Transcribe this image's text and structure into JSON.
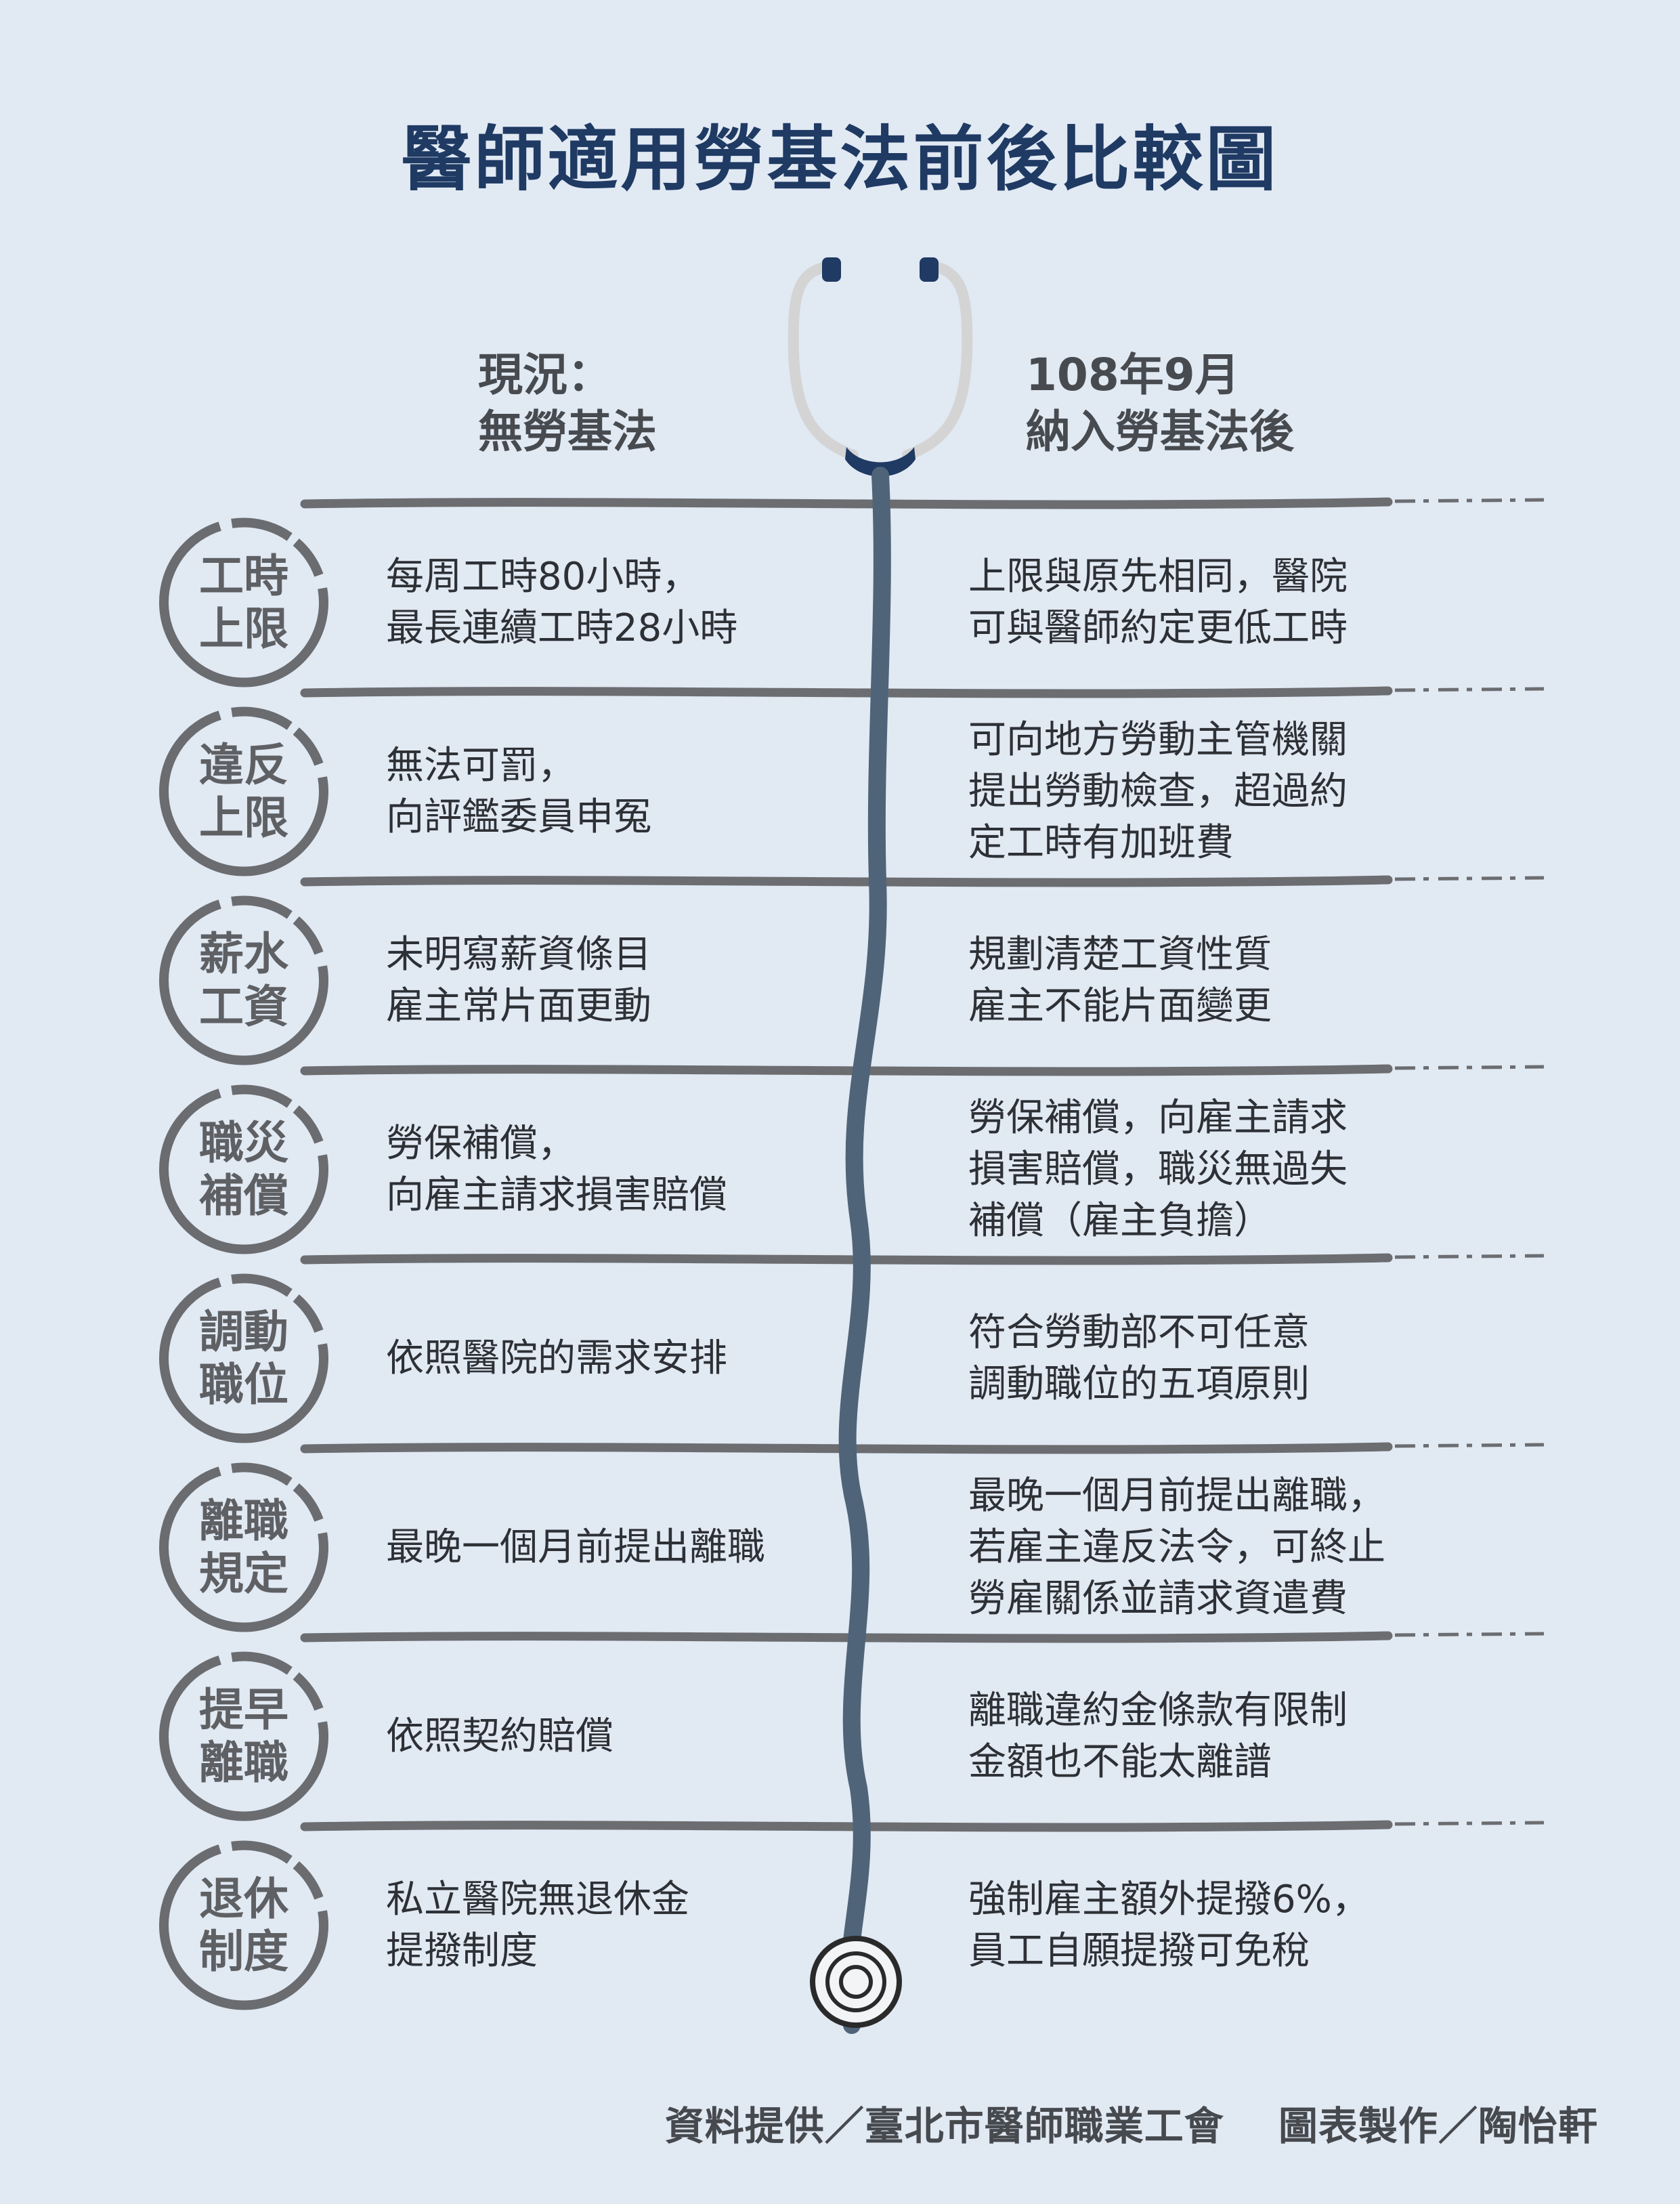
{
  "title": "醫師適用勞基法前後比較圖",
  "header": {
    "left": [
      "現況：",
      "無勞基法"
    ],
    "right": [
      "108年9月",
      "納入勞基法後"
    ]
  },
  "rows": [
    {
      "label": [
        "工時",
        "上限"
      ],
      "before": [
        "每周工時80小時，",
        "最長連續工時28小時"
      ],
      "after": [
        "上限與原先相同，醫院",
        "可與醫師約定更低工時"
      ]
    },
    {
      "label": [
        "違反",
        "上限"
      ],
      "before": [
        "無法可罰，",
        "向評鑑委員申冤"
      ],
      "after": [
        "可向地方勞動主管機關",
        "提出勞動檢查，超過約",
        "定工時有加班費"
      ]
    },
    {
      "label": [
        "薪水",
        "工資"
      ],
      "before": [
        "未明寫薪資條目",
        "雇主常片面更動"
      ],
      "after": [
        "規劃清楚工資性質",
        "雇主不能片面變更"
      ]
    },
    {
      "label": [
        "職災",
        "補償"
      ],
      "before": [
        "勞保補償，",
        "向雇主請求損害賠償"
      ],
      "after": [
        "勞保補償，向雇主請求",
        "損害賠償，職災無過失",
        "補償（雇主負擔）"
      ]
    },
    {
      "label": [
        "調動",
        "職位"
      ],
      "before": [
        "依照醫院的需求安排"
      ],
      "after": [
        "符合勞動部不可任意",
        "調動職位的五項原則"
      ]
    },
    {
      "label": [
        "離職",
        "規定"
      ],
      "before": [
        "最晚一個月前提出離職"
      ],
      "after": [
        "最晚一個月前提出離職，",
        "若雇主違反法令，可終止",
        "勞雇關係並請求資遣費"
      ]
    },
    {
      "label": [
        "提早",
        "離職"
      ],
      "before": [
        "依照契約賠償"
      ],
      "after": [
        "離職違約金條款有限制",
        "金額也不能太離譜"
      ]
    },
    {
      "label": [
        "退休",
        "制度"
      ],
      "before": [
        "私立醫院無退休金",
        "提撥制度"
      ],
      "after": [
        "強制雇主額外提撥6%，",
        "員工自願提撥可免稅"
      ]
    }
  ],
  "footer": "資料提供／臺北市醫師職業工會　 圖表製作／陶怡軒",
  "colors": {
    "background": "#e1e9f3",
    "title": "#1f3a63",
    "stethoscope_tube": "#4f6478",
    "divider": "#6b6d71",
    "badge": "#6a6c70"
  }
}
